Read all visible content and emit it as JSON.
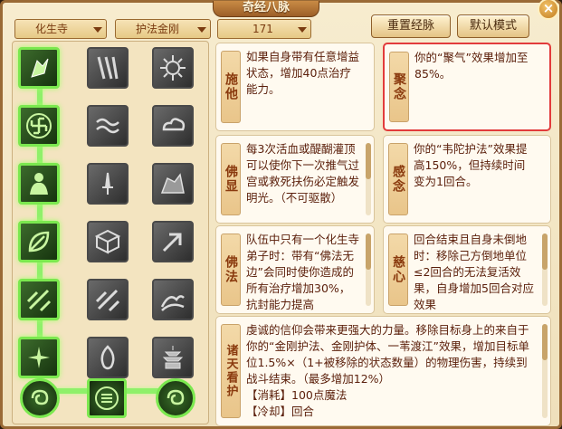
{
  "window": {
    "title": "奇经八脉",
    "close_label": "×"
  },
  "toolbar": {
    "school": "化生寺",
    "talent": "护法金刚",
    "points": "171",
    "reset_label": "重置经脉",
    "default_label": "默认模式"
  },
  "cards": [
    {
      "label": "施他",
      "text": "如果自身带有任意增益状态，增加40点治疗能力。"
    },
    {
      "label": "聚念",
      "text": "你的“聚气”效果增加至85%。"
    },
    {
      "label": "佛显",
      "text": "每3次活血或醍醐灌顶可以使你下一次推气过宫或救死扶伤必定触发明光。（不可驱散）"
    },
    {
      "label": "感念",
      "text": "你的“韦陀护法”效果提高150%，但持续时间变为1回合。"
    },
    {
      "label": "佛法",
      "text": "队伍中只有一个化生寺弟子时：带有“佛法无边”会同时使你造成的所有治疗增加30%，抗封能力提高"
    },
    {
      "label": "慈心",
      "text": "回合结束且自身未倒地时：移除己方倒地单位≤2回合的无法复活效果，自身增加5回合对应效果"
    },
    {
      "label": "诸天看护",
      "text": "虔诚的信仰会带来更强大的力量。移除目标身上的来自于你的“金刚护法、金刚护体、一苇渡江”效果，增加目标单位1.5%×（1+被移除的状态数量）的物理伤害，持续到战斗结束。（最多增加12%）",
      "cost": "【消耗】100点魔法",
      "extra": "【冷却】回合"
    }
  ]
}
